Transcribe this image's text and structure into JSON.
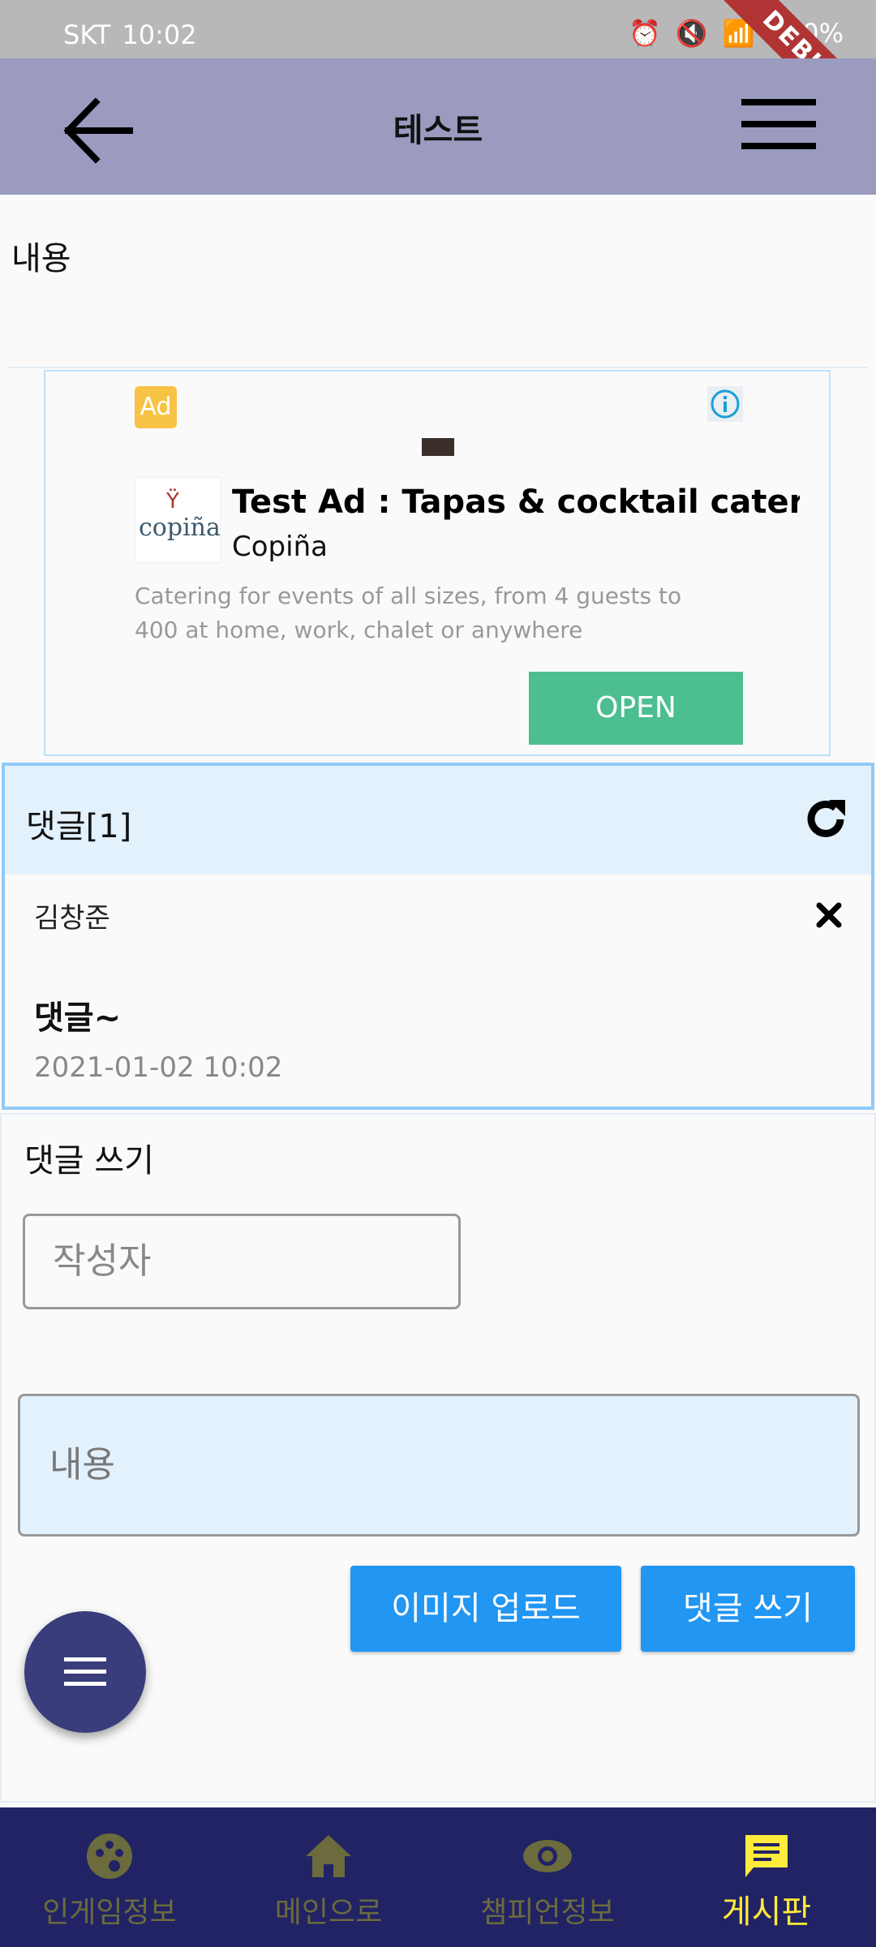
{
  "status_bar": {
    "carrier": "SKT",
    "time": "10:02",
    "battery": "100%"
  },
  "debug_banner": "DEBUG",
  "app_bar": {
    "title": "테스트"
  },
  "post": {
    "content": "내용"
  },
  "ad": {
    "badge": "Ad",
    "headline": "Test Ad : Tapas & cocktail cater…",
    "advertiser": "Copiña",
    "logo_text": "copiña",
    "body": "Catering for events of all sizes, from 4 guests to 400 at home, work, chalet or anywhere",
    "cta": "OPEN"
  },
  "comments": {
    "header": "댓글[1]",
    "items": [
      {
        "author": "김창준",
        "text": "댓글~",
        "date": "2021-01-02 10:02"
      }
    ]
  },
  "write": {
    "title": "댓글 쓰기",
    "author_placeholder": "작성자",
    "content_placeholder": "내용",
    "upload_label": "이미지 업로드",
    "submit_label": "댓글 쓰기"
  },
  "bottom_nav": [
    {
      "label": "인게임정보",
      "icon": "palette-icon"
    },
    {
      "label": "메인으로",
      "icon": "home-icon"
    },
    {
      "label": "챔피언정보",
      "icon": "eye-icon"
    },
    {
      "label": "게시판",
      "icon": "chat-icon",
      "active": true
    }
  ],
  "colors": {
    "app_bar": "#9a9bbf",
    "accent": "#2196f3",
    "nav_bg": "#222364",
    "nav_active": "#ffeb3b"
  }
}
